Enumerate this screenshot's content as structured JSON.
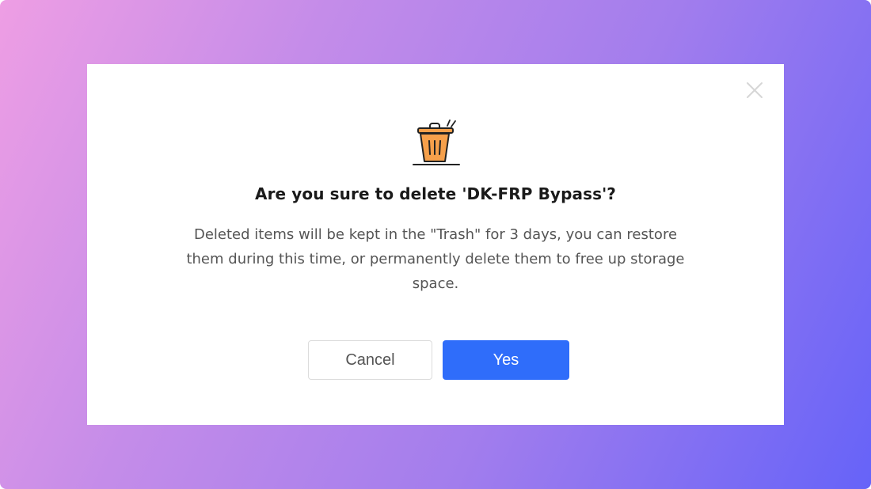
{
  "dialog": {
    "title": "Are you sure to delete 'DK-FRP Bypass'?",
    "message": "Deleted items will be kept in the \"Trash\" for 3 days, you can restore them during this time, or permanently delete them to free up storage space.",
    "cancel_label": "Cancel",
    "confirm_label": "Yes",
    "icon": "trash-icon",
    "close_icon": "close-icon"
  },
  "colors": {
    "backdrop_gradient": [
      "#ee9ee4",
      "#a27ded",
      "#6663f8"
    ],
    "confirm_button": "#2f6dfa",
    "trash_fill": "#f6a04b"
  }
}
